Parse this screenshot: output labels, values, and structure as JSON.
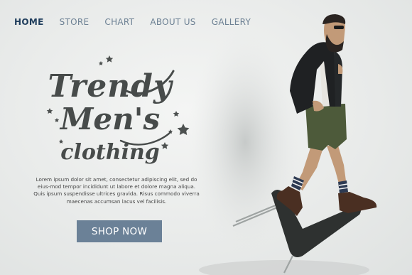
{
  "nav": {
    "items": [
      {
        "label": "HOME",
        "active": true
      },
      {
        "label": "STORE",
        "active": false
      },
      {
        "label": "CHART",
        "active": false
      },
      {
        "label": "ABOUT US",
        "active": false
      },
      {
        "label": "GALLERY",
        "active": false
      }
    ]
  },
  "hero": {
    "title_line1": "Trendy",
    "title_line2": "Men's",
    "title_line3": "clothing",
    "description": "Lorem ipsum dolor sit amet, consectetur adipiscing elit, sed do eius-mod tempor incididunt ut labore et dolore magna aliqua. Quis ipsum suspendisse ultrices gravida. Risus commodo viverra maecenas accumsan lacus vel facilisis.",
    "cta_label": "SHOP NOW"
  },
  "colors": {
    "nav_active": "#1f3d5c",
    "nav_inactive": "#6d8194",
    "button_bg": "#6b8197",
    "title_text": "#474b4a"
  },
  "icons": [
    "star-icon"
  ]
}
